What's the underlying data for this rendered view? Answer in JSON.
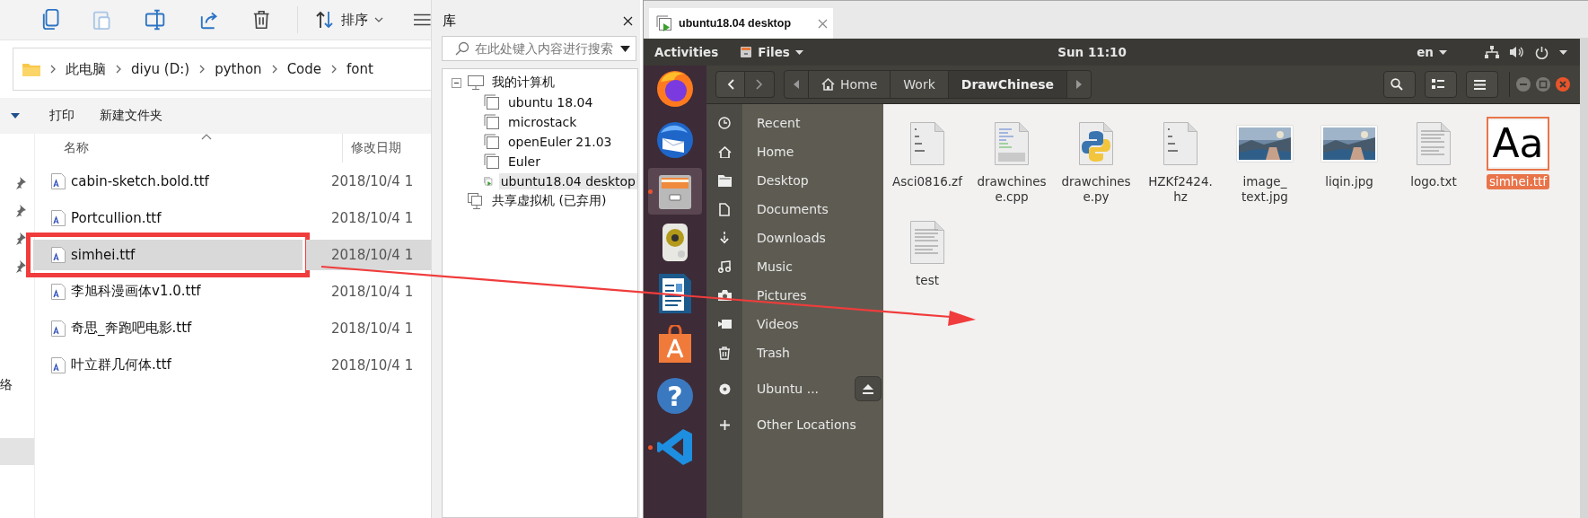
{
  "explorer": {
    "sort_label": "排序",
    "breadcrumb": [
      "此电脑",
      "diyu (D:)",
      "python",
      "Code",
      "font"
    ],
    "commands": [
      "打印",
      "新建文件夹"
    ],
    "columns": [
      "名称",
      "修改日期"
    ],
    "nav_items": [
      {
        "label": "络",
        "selected": false
      },
      {
        "selected": true
      }
    ],
    "rows": [
      {
        "name": "cabin-sketch.bold.ttf",
        "date": "2018/10/4 1",
        "selected": false,
        "outlined": false
      },
      {
        "name": "Portcullion.ttf",
        "date": "2018/10/4 1",
        "selected": false,
        "outlined": false
      },
      {
        "name": "simhei.ttf",
        "date": "2018/10/4 1",
        "selected": true,
        "outlined": true
      },
      {
        "name": "李旭科漫画体v1.0.ttf",
        "date": "2018/10/4 1",
        "selected": false,
        "outlined": false
      },
      {
        "name": "奇思_奔跑吧电影.ttf",
        "date": "2018/10/4 1",
        "selected": false,
        "outlined": false
      },
      {
        "name": "叶立群几何体.ttf",
        "date": "2018/10/4 1",
        "selected": false,
        "outlined": false
      }
    ]
  },
  "library": {
    "title": "库",
    "search": {
      "placeholder": "在此处键入内容进行搜索"
    },
    "tree": [
      {
        "label": "我的计算机",
        "kind": "computer",
        "expanded": true,
        "selected": false,
        "children": [
          {
            "label": "ubuntu 18.04",
            "running": false,
            "selected": false
          },
          {
            "label": "microstack",
            "running": false,
            "selected": false
          },
          {
            "label": "openEuler 21.03",
            "running": false,
            "selected": false
          },
          {
            "label": "Euler",
            "running": false,
            "selected": false
          },
          {
            "label": "ubuntu18.04 desktop",
            "running": true,
            "selected": true
          }
        ]
      },
      {
        "label": "共享虚拟机 (已弃用)",
        "kind": "shared",
        "selected": false
      }
    ]
  },
  "vm": {
    "tab": {
      "label": "ubuntu18.04 desktop",
      "running": true
    },
    "topbar": {
      "activities": "Activities",
      "app": "Files",
      "clock": "Sun 11:10",
      "language": "en"
    },
    "dock": [
      {
        "kind": "firefox",
        "running": false,
        "selected": false
      },
      {
        "kind": "mail",
        "running": false,
        "selected": false
      },
      {
        "kind": "files",
        "running": true,
        "selected": true
      },
      {
        "kind": "speaker",
        "running": false,
        "selected": false
      },
      {
        "kind": "writer",
        "running": false,
        "selected": false
      },
      {
        "kind": "store",
        "running": false,
        "selected": false
      },
      {
        "kind": "help",
        "glyph": "?",
        "running": false,
        "selected": false
      },
      {
        "kind": "code",
        "running": true,
        "selected": false
      }
    ],
    "path": [
      {
        "label": "Home",
        "kind": "home",
        "selected": false
      },
      {
        "label": "Work",
        "kind": "folder",
        "selected": false
      },
      {
        "label": "DrawChinese",
        "kind": "folder",
        "selected": true
      }
    ],
    "places": [
      {
        "label": "Recent",
        "kind": "recent"
      },
      {
        "label": "Home",
        "kind": "home"
      },
      {
        "label": "Desktop",
        "kind": "folder"
      },
      {
        "label": "Documents",
        "kind": "document"
      },
      {
        "label": "Downloads",
        "kind": "download"
      },
      {
        "label": "Music",
        "kind": "music"
      },
      {
        "label": "Pictures",
        "kind": "camera"
      },
      {
        "label": "Videos",
        "kind": "video"
      },
      {
        "label": "Trash",
        "kind": "trash"
      },
      {
        "label": "Ubuntu ...",
        "kind": "disc",
        "eject": true
      },
      {
        "label": "Other Locations",
        "kind": "plus"
      }
    ],
    "files": [
      {
        "name": "Asci0816.zf",
        "kind": "binary",
        "selected": false
      },
      {
        "name": "drawchinese.cpp",
        "kind": "cpp",
        "selected": false
      },
      {
        "name": "drawchinese.py",
        "kind": "python",
        "selected": false
      },
      {
        "name": "HZKf2424.hz",
        "kind": "binary",
        "selected": false
      },
      {
        "name": "image_text.jpg",
        "kind": "picture",
        "selected": false
      },
      {
        "name": "liqin.jpg",
        "kind": "picture",
        "selected": false
      },
      {
        "name": "logo.txt",
        "kind": "text",
        "selected": false
      },
      {
        "name": "simhei.ttf",
        "kind": "font",
        "preview": "Aa",
        "selected": true
      },
      {
        "name": "test",
        "kind": "text",
        "selected": false
      }
    ]
  },
  "annotations": [
    {
      "kind": "arrow"
    }
  ]
}
